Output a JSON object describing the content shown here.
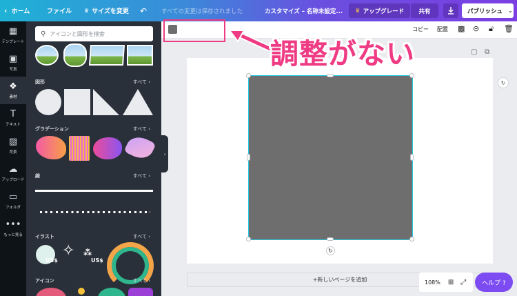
{
  "colors": {
    "accent": "#7d4bf2",
    "annotation": "#ee3b83",
    "selection": "#29c8e4",
    "element_fill": "#6e6e6e"
  },
  "topbar": {
    "home": "ホーム",
    "file": "ファイル",
    "resize": "サイズを変更",
    "undo_icon": "undo-icon",
    "saved_status": "すべての変更は保存されました",
    "doc_title": "カスタマイズ – 名称未設定...",
    "upgrade": "アップグレード",
    "share": "共有",
    "download_icon": "download-icon",
    "publish": "パブリッシュ"
  },
  "rail": [
    {
      "label": "テンプレート",
      "icon": "template-icon"
    },
    {
      "label": "写真",
      "icon": "photo-icon"
    },
    {
      "label": "素材",
      "icon": "elements-icon"
    },
    {
      "label": "テキスト",
      "icon": "text-icon"
    },
    {
      "label": "背景",
      "icon": "background-icon"
    },
    {
      "label": "アップロード",
      "icon": "upload-icon"
    },
    {
      "label": "フォルダ",
      "icon": "folder-icon"
    },
    {
      "label": "もっと見る",
      "icon": "more-icon"
    }
  ],
  "panel": {
    "search_placeholder": "アイコンと図形を検索",
    "see_all": "すべて ›",
    "sections": {
      "shapes": "図形",
      "gradients": "グラデーション",
      "lines": "線",
      "illustrations": "イラスト",
      "icons": "アイコン"
    },
    "price_tag": "US$"
  },
  "toolbar": {
    "copy": "コピー",
    "arrange": "配置"
  },
  "canvas": {
    "add_page": "+新しいページを追加",
    "zoom": "108%",
    "help": "ヘルプ ?"
  },
  "annotation": {
    "text": "調整がない"
  }
}
